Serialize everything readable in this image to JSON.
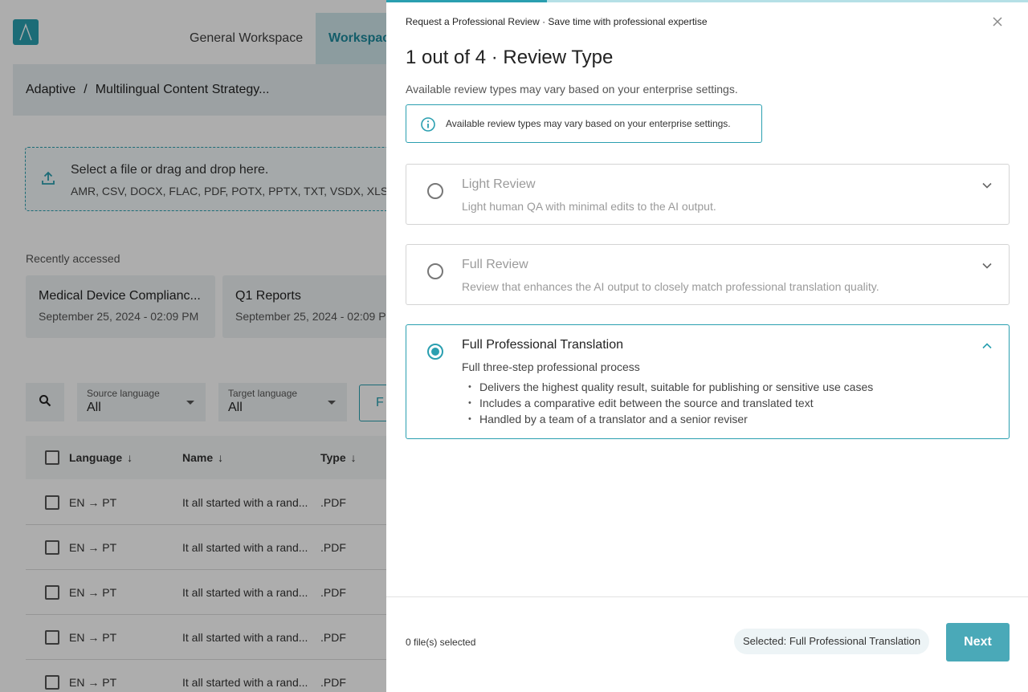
{
  "app": {
    "logo_icon": "adaptive-logo-icon",
    "tabs": [
      {
        "label": "General Workspace"
      },
      {
        "label": "Workspac"
      }
    ],
    "breadcrumb": {
      "root": "Adaptive",
      "separator": "/",
      "current": "Multilingual Content Strategy..."
    },
    "upload": {
      "title": "Select a file or drag and drop here.",
      "types": "AMR, CSV, DOCX, FLAC, PDF, POTX, PPTX, TXT, VSDX, XLSX, X"
    },
    "recent": {
      "label": "Recently accessed",
      "cards": [
        {
          "title": "Medical Device Complianc...",
          "date": "September 25, 2024 - 02:09 PM"
        },
        {
          "title": "Q1 Reports",
          "date": "September 25, 2024 - 02:09 P"
        }
      ]
    },
    "filters": {
      "source": {
        "label": "Source language",
        "value": "All"
      },
      "target": {
        "label": "Target language",
        "value": "All"
      },
      "button": "F"
    },
    "table": {
      "headers": [
        "Language",
        "Name",
        "Type"
      ],
      "sort_glyph": "↓",
      "rows": [
        {
          "language": "EN → PT",
          "name": "It all started with a rand...",
          "type": ".PDF"
        },
        {
          "language": "EN → PT",
          "name": "It all started with a rand...",
          "type": ".PDF"
        },
        {
          "language": "EN → PT",
          "name": "It all started with a rand...",
          "type": ".PDF"
        },
        {
          "language": "EN → PT",
          "name": "It all started with a rand...",
          "type": ".PDF"
        },
        {
          "language": "EN → PT",
          "name": "It all started with a rand...",
          "type": ".PDF"
        }
      ]
    }
  },
  "drawer": {
    "header": "Request a Professional Review · Save time with professional expertise",
    "progress": {
      "current": 1,
      "total": 4
    },
    "title": "1 out of 4 · Review Type",
    "subtitle": "Available review types may vary based on your enterprise settings.",
    "info": "Available review types may vary based on your enterprise settings.",
    "options": [
      {
        "title": "Light Review",
        "description": "Light human QA with minimal edits to the AI output.",
        "selected": false
      },
      {
        "title": "Full Review",
        "description": "Review that enhances the AI output to closely match professional translation quality.",
        "selected": false
      },
      {
        "title": "Full Professional Translation",
        "description": "Full three-step professional process",
        "selected": true,
        "bullets": [
          "Delivers the highest quality result, suitable for publishing or sensitive use cases",
          "Includes a comparative edit between the source and translated text",
          "Handled by a team of a translator and a senior reviser"
        ]
      }
    ],
    "footer": {
      "files_selected": "0 file(s) selected",
      "selected_chip": "Selected: Full Professional Translation",
      "next_label": "Next"
    }
  },
  "colors": {
    "accent": "#2a9fb0",
    "next_button": "#4aa9b8",
    "progress_track": "#b5e0e6"
  }
}
